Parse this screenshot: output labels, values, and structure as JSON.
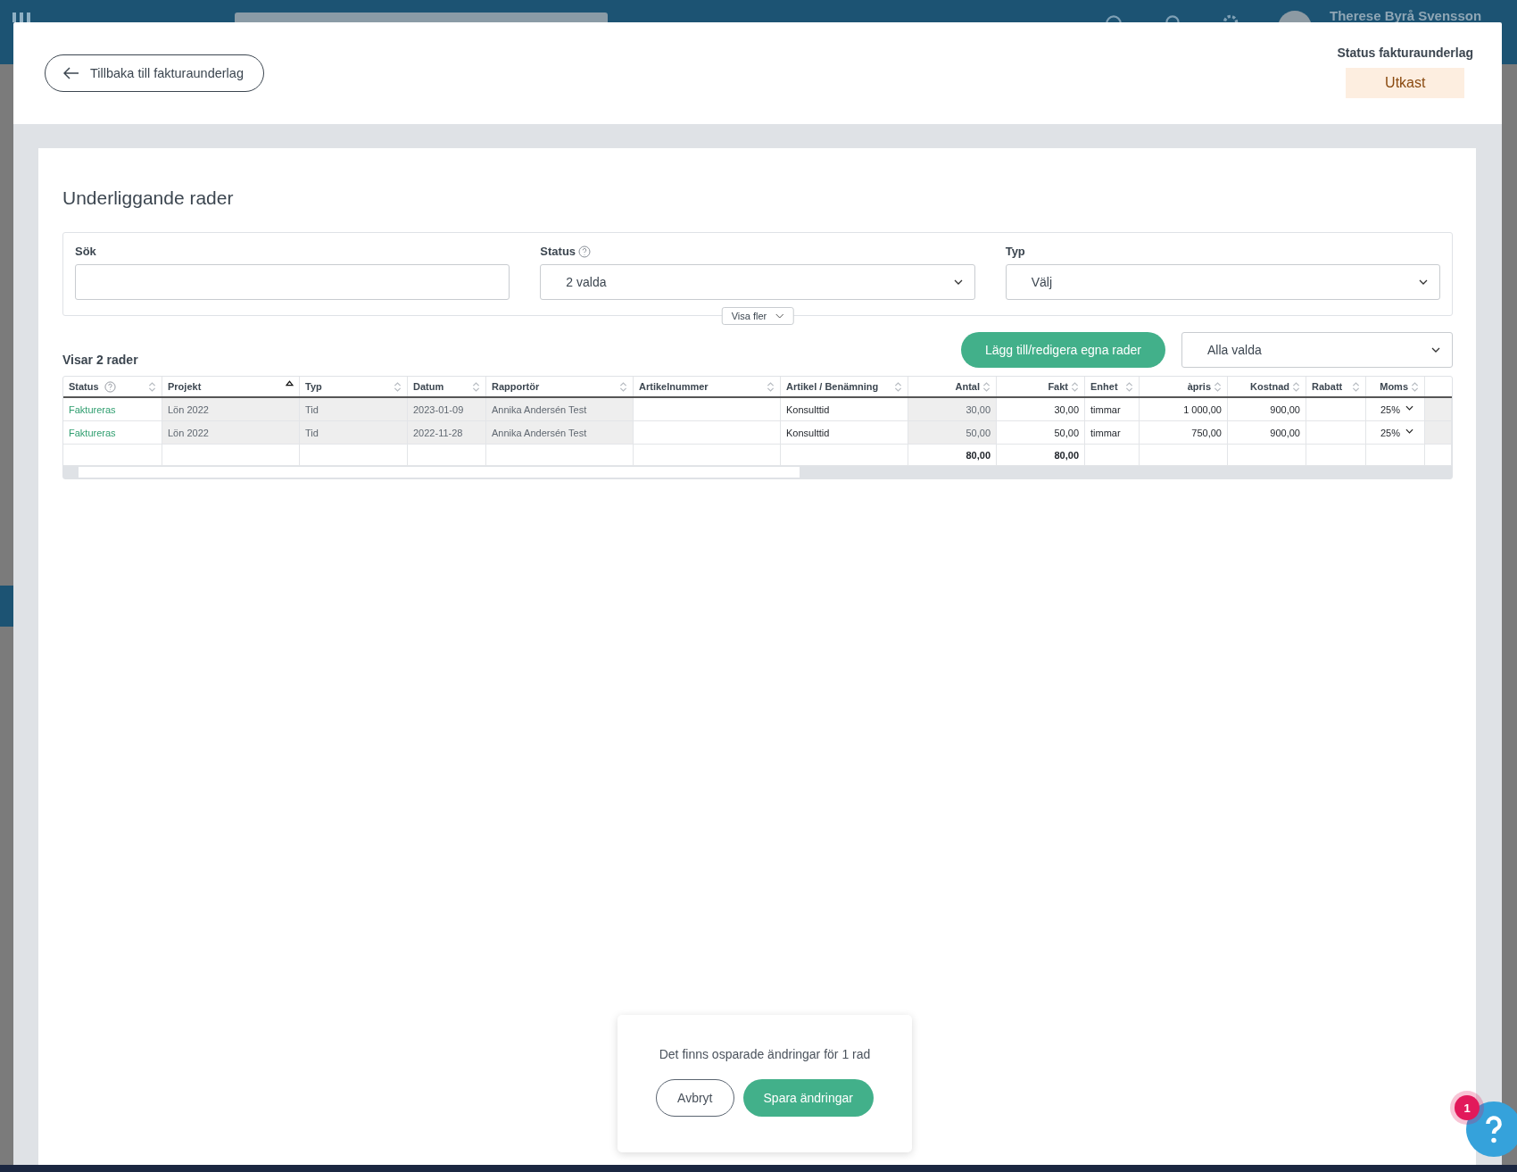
{
  "topbar": {
    "user_name": "Therese Byrå Svensson"
  },
  "header": {
    "back_button": "Tillbaka till fakturaunderlag",
    "status_label": "Status fakturaunderlag",
    "status_value": "Utkast"
  },
  "section_title": "Underliggande rader",
  "filters": {
    "search": {
      "label": "Sök"
    },
    "status": {
      "label": "Status",
      "value": "2 valda"
    },
    "type": {
      "label": "Typ",
      "placeholder": "Välj"
    },
    "show_more": "Visa fler"
  },
  "row_count": "Visar 2 rader",
  "add_button": "Lägg till/redigera egna rader",
  "selection_dropdown": "Alla valda",
  "table": {
    "columns": [
      {
        "label": "Status",
        "kind": "status",
        "sorted": false,
        "readonly": false,
        "help": true
      },
      {
        "label": "Projekt",
        "kind": "text",
        "sorted": true,
        "readonly": true,
        "help": false
      },
      {
        "label": "Typ",
        "kind": "text",
        "sorted": false,
        "readonly": true,
        "help": false
      },
      {
        "label": "Datum",
        "kind": "text",
        "sorted": false,
        "readonly": true,
        "help": false
      },
      {
        "label": "Rapportör",
        "kind": "text",
        "sorted": false,
        "readonly": true,
        "help": false
      },
      {
        "label": "Artikelnummer",
        "kind": "text",
        "sorted": false,
        "readonly": false,
        "help": false
      },
      {
        "label": "Artikel / Benämning",
        "kind": "text",
        "sorted": false,
        "readonly": false,
        "help": false
      },
      {
        "label": "Antal",
        "kind": "number",
        "sorted": false,
        "readonly": true,
        "help": false,
        "total": "80,00"
      },
      {
        "label": "Fakt",
        "kind": "number",
        "sorted": false,
        "readonly": false,
        "help": false,
        "total": "80,00"
      },
      {
        "label": "Enhet",
        "kind": "text",
        "sorted": false,
        "readonly": false,
        "help": false
      },
      {
        "label": "àpris",
        "kind": "number",
        "sorted": false,
        "readonly": false,
        "help": false
      },
      {
        "label": "Kostnad",
        "kind": "number",
        "sorted": false,
        "readonly": false,
        "help": false
      },
      {
        "label": "Rabatt",
        "kind": "text",
        "sorted": false,
        "readonly": false,
        "help": false
      },
      {
        "label": "Moms",
        "kind": "select",
        "sorted": false,
        "readonly": false,
        "help": false
      }
    ],
    "rows": [
      {
        "status": "Faktureras",
        "project": "Lön 2022",
        "type": "Tid",
        "date": "2023-01-09",
        "reporter": "Annika Andersén Test",
        "article": "Konsulttid",
        "quantity": "30,00",
        "invoiced": "30,00",
        "unit": "timmar",
        "unit_price": "1 000,00",
        "cost": "900,00",
        "vat": "25%"
      },
      {
        "status": "Faktureras",
        "project": "Lön 2022",
        "type": "Tid",
        "date": "2022-11-28",
        "reporter": "Annika Andersén Test",
        "article": "Konsulttid",
        "quantity": "50,00",
        "invoiced": "50,00",
        "unit": "timmar",
        "unit_price": "750,00",
        "cost": "900,00",
        "vat": "25%"
      }
    ]
  },
  "unsaved_popup": {
    "message": "Det finns osparade ändringar för 1 rad",
    "cancel": "Avbryt",
    "save": "Spara ändringar"
  },
  "help_badge": "1"
}
